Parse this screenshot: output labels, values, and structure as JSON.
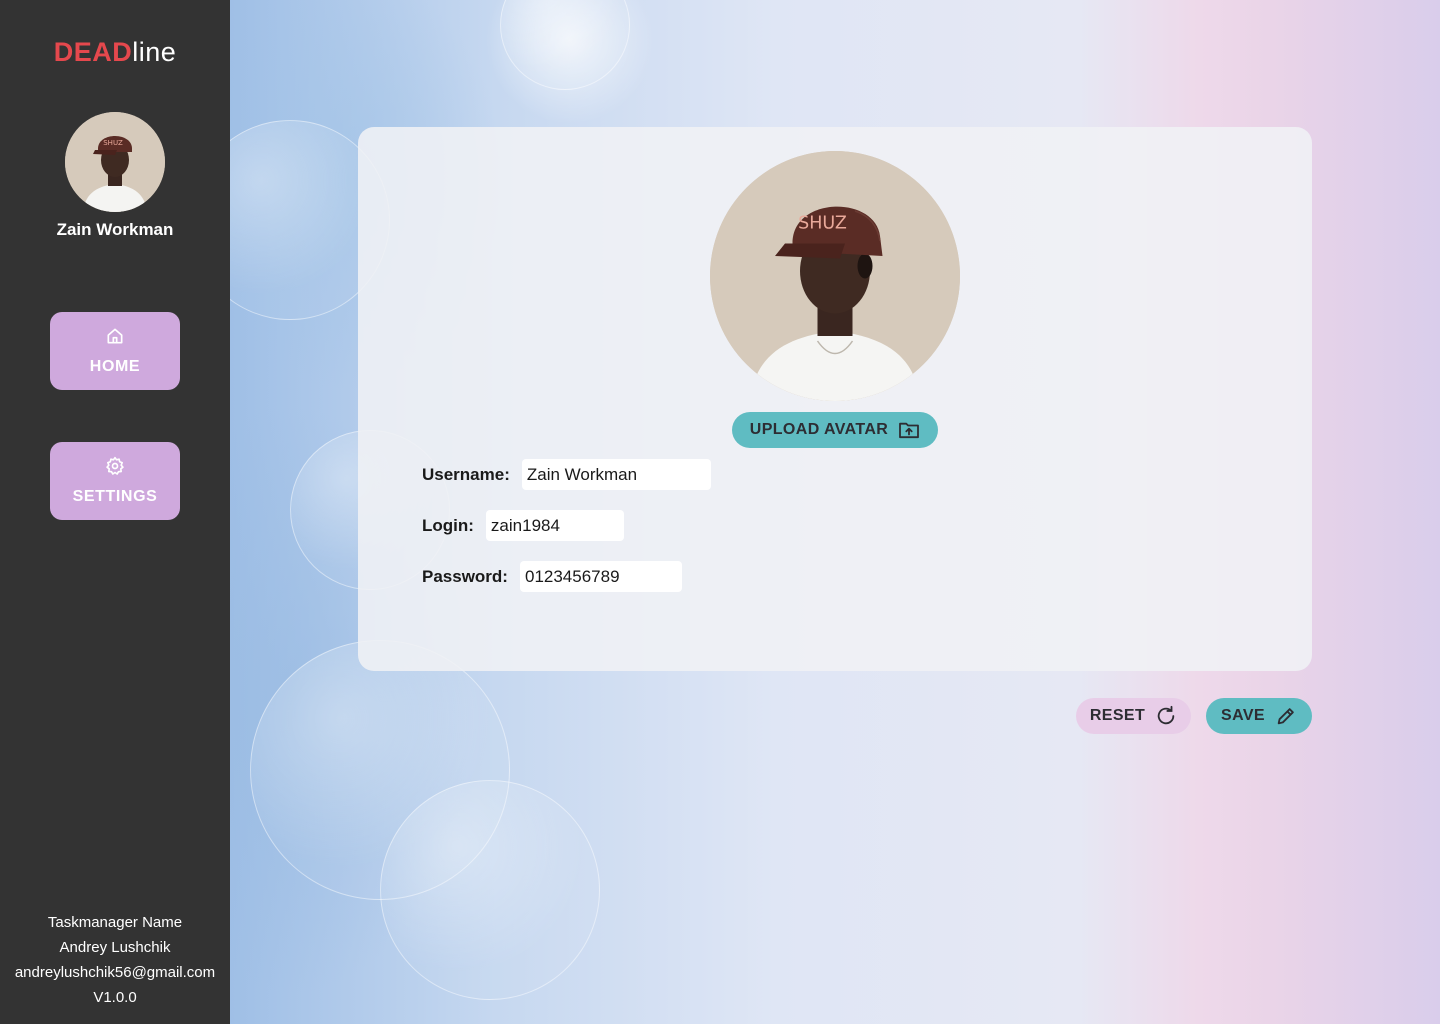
{
  "sidebar": {
    "logo_bold": "DEAD",
    "logo_light": "line",
    "user_name": "Zain Workman",
    "nav": [
      {
        "label": "HOME",
        "icon": "home-icon"
      },
      {
        "label": "SETTINGS",
        "icon": "gear-icon"
      }
    ],
    "footer": {
      "app_name": "Taskmanager Name",
      "author": "Andrey Lushchik",
      "email": "andreylushchik56@gmail.com",
      "version": "V1.0.0"
    }
  },
  "profile": {
    "upload_label": "UPLOAD AVATAR",
    "upload_icon": "folder-upload-icon",
    "fields": {
      "username_label": "Username:",
      "username_value": "Zain Workman",
      "login_label": "Login:",
      "login_value": "zain1984",
      "password_label": "Password:",
      "password_value": "0123456789"
    }
  },
  "actions": {
    "reset_label": "RESET",
    "reset_icon": "refresh-icon",
    "save_label": "SAVE",
    "save_icon": "pencil-icon"
  },
  "colors": {
    "sidebar_bg": "#333333",
    "logo_accent": "#e5484d",
    "nav_button": "#cfa9dd",
    "teal_button": "#5fbcc2",
    "reset_button": "#e8cde8"
  }
}
